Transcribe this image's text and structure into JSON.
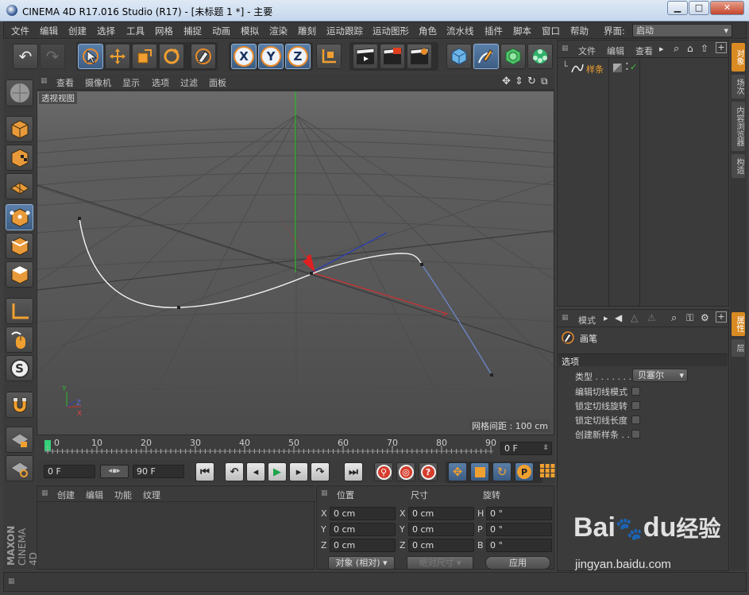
{
  "titlebar": {
    "title": "CINEMA 4D R17.016 Studio (R17) - [未标题 1 *] - 主要",
    "min": "▁",
    "max": "□",
    "close": "✕"
  },
  "menubar": {
    "items": [
      "文件",
      "编辑",
      "创建",
      "选择",
      "工具",
      "网格",
      "捕捉",
      "动画",
      "模拟",
      "渲染",
      "雕刻",
      "运动跟踪",
      "运动图形",
      "角色",
      "流水线",
      "插件",
      "脚本",
      "窗口",
      "帮助"
    ],
    "interface_label": "界面:",
    "interface_value": "启动"
  },
  "viewport": {
    "menu": [
      "查看",
      "摄像机",
      "显示",
      "选项",
      "过滤",
      "面板"
    ],
    "title": "透视视图",
    "grid_info": "网格间距 : 100 cm"
  },
  "timeline": {
    "ticks": [
      "0",
      "10",
      "20",
      "30",
      "40",
      "50",
      "60",
      "70",
      "80",
      "90"
    ],
    "current_frame": "0 F"
  },
  "transport": {
    "start_field": "0 F",
    "end_field": "90 F"
  },
  "material_manager": {
    "menu": [
      "创建",
      "编辑",
      "功能",
      "纹理"
    ]
  },
  "coord_manager": {
    "headers": {
      "position": "位置",
      "size": "尺寸",
      "rotation": "旋转"
    },
    "rows": [
      {
        "axis": "X",
        "pos": "0 cm",
        "saxis": "X",
        "size": "0 cm",
        "raxis": "H",
        "rot": "0 °"
      },
      {
        "axis": "Y",
        "pos": "0 cm",
        "saxis": "Y",
        "size": "0 cm",
        "raxis": "P",
        "rot": "0 °"
      },
      {
        "axis": "Z",
        "pos": "0 cm",
        "saxis": "Z",
        "size": "0 cm",
        "raxis": "B",
        "rot": "0 °"
      }
    ],
    "mode": "对象 (相对)",
    "absolute": "绝对尺寸",
    "apply": "应用"
  },
  "object_manager": {
    "menu": [
      "文件",
      "编辑",
      "查看"
    ],
    "objects": [
      {
        "name": "样条"
      }
    ]
  },
  "attribute_manager": {
    "mode": "模式",
    "tool_name": "画笔",
    "section": "选项",
    "type_label": "类型 . . . . . . .",
    "type_value": "贝塞尔",
    "options": [
      "编辑切线模式",
      "锁定切线旋转",
      "锁定切线长度",
      "创建新样条 . ."
    ]
  },
  "side_tabs": {
    "top": [
      "对象",
      "场次",
      "内容浏览器",
      "构造"
    ],
    "bottom": [
      "属性",
      "层"
    ]
  },
  "branding": {
    "maxon": "MAXON",
    "cinema": "CINEMA 4D"
  },
  "watermark": {
    "brand": "Bai",
    "brand2": "du",
    "jingyan": "经验",
    "url": "jingyan.baidu.com"
  },
  "colors": {
    "accent": "#d98a22",
    "selected": "#4d6f98",
    "x_axis": "#c83232",
    "y_axis": "#2eb82e",
    "z_axis": "#2b3fb0",
    "spline": "#f0f0f0",
    "arrow": "#e02020"
  }
}
